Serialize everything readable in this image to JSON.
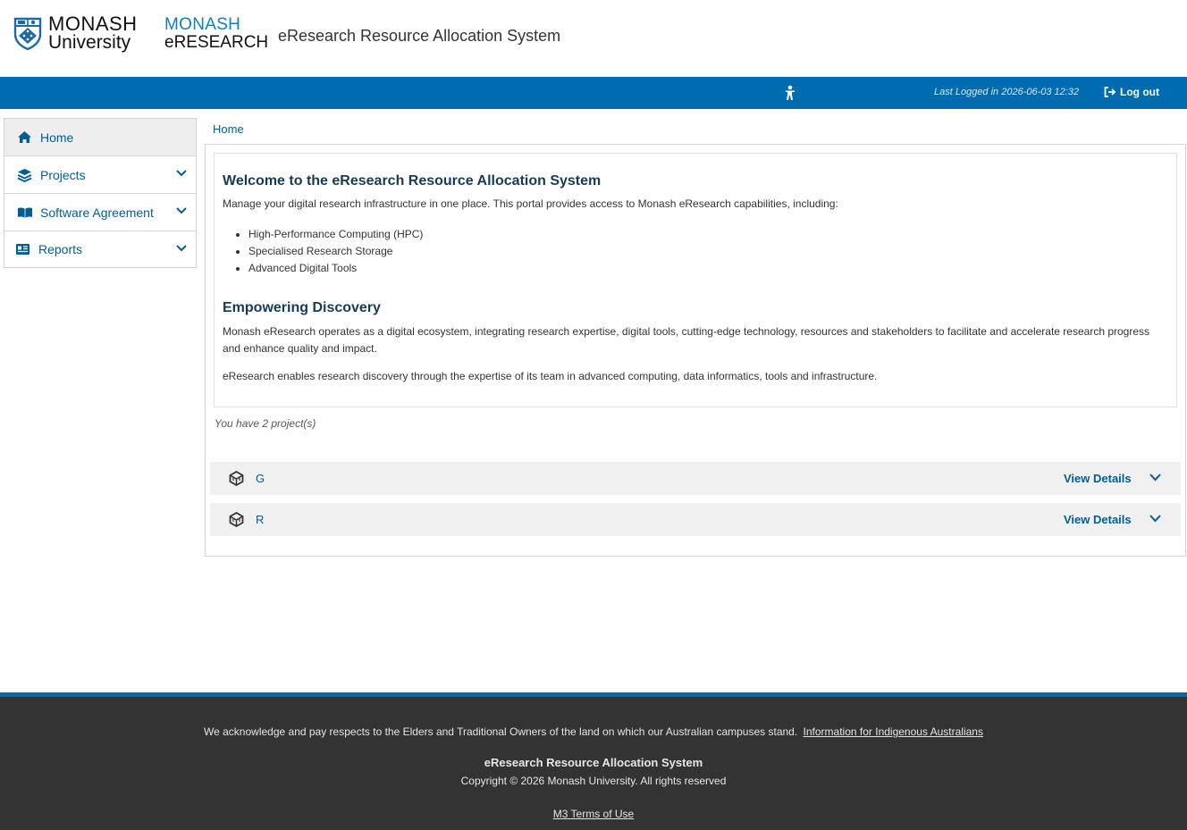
{
  "header": {
    "university_line1": "MONASH",
    "university_line2": "University",
    "eresearch_line1": "MONASH",
    "eresearch_line2": "eRESEARCH",
    "app_title": "eResearch Resource Allocation System"
  },
  "topbar": {
    "last_logged": "Last Logged in 2026-06-03 12:32",
    "logout_label": "Log out",
    "accessibility_icon": "person-icon"
  },
  "sidebar": {
    "items": [
      {
        "label": "Home",
        "icon": "home-icon",
        "active": true
      },
      {
        "label": "Projects",
        "icon": "layers-icon",
        "active": false
      },
      {
        "label": "Software Agreement",
        "icon": "book-icon",
        "active": false
      },
      {
        "label": "Reports",
        "icon": "report-icon",
        "active": false
      }
    ]
  },
  "breadcrumb": "Home",
  "welcome": {
    "title": "Welcome to the eResearch Resource Allocation System",
    "intro": "Manage your digital research infrastructure in one place. This portal provides access to Monash eResearch capabilities, including:",
    "capabilities": [
      "High-Performance Computing (HPC)",
      "Specialised Research Storage",
      "Advanced Digital Tools"
    ],
    "discovery_title": "Empowering Discovery",
    "discovery_p1": "Monash eResearch operates as a digital ecosystem, integrating research expertise, digital tools, cutting-edge technology, resources and stakeholders to facilitate and accelerate research progress and enhance quality and impact.",
    "discovery_p2": "eResearch enables research discovery through the expertise of its team in advanced computing, data informatics, tools and infrastructure."
  },
  "projects": {
    "count_text": "You have 2 project(s)",
    "items": [
      {
        "name": "G",
        "action": "View Details",
        "icon": "cube-icon"
      },
      {
        "name": "R",
        "action": "View Details",
        "icon": "cube-icon"
      }
    ]
  },
  "footer": {
    "acknowledgement": "We acknowledge and pay respects to the Elders and Traditional Owners of the land on which our Australian campuses stand.",
    "indigenous_link": "Information for Indigenous Australians",
    "title": "eResearch Resource Allocation System",
    "copyright": "Copyright © 2026 Monash University. All rights reserved",
    "terms_link": "M3 Terms of Use"
  },
  "colors": {
    "brand_blue": "#006cb0",
    "link_blue": "#005d97",
    "heading": "#173b56",
    "footer_bg": "#333333"
  }
}
